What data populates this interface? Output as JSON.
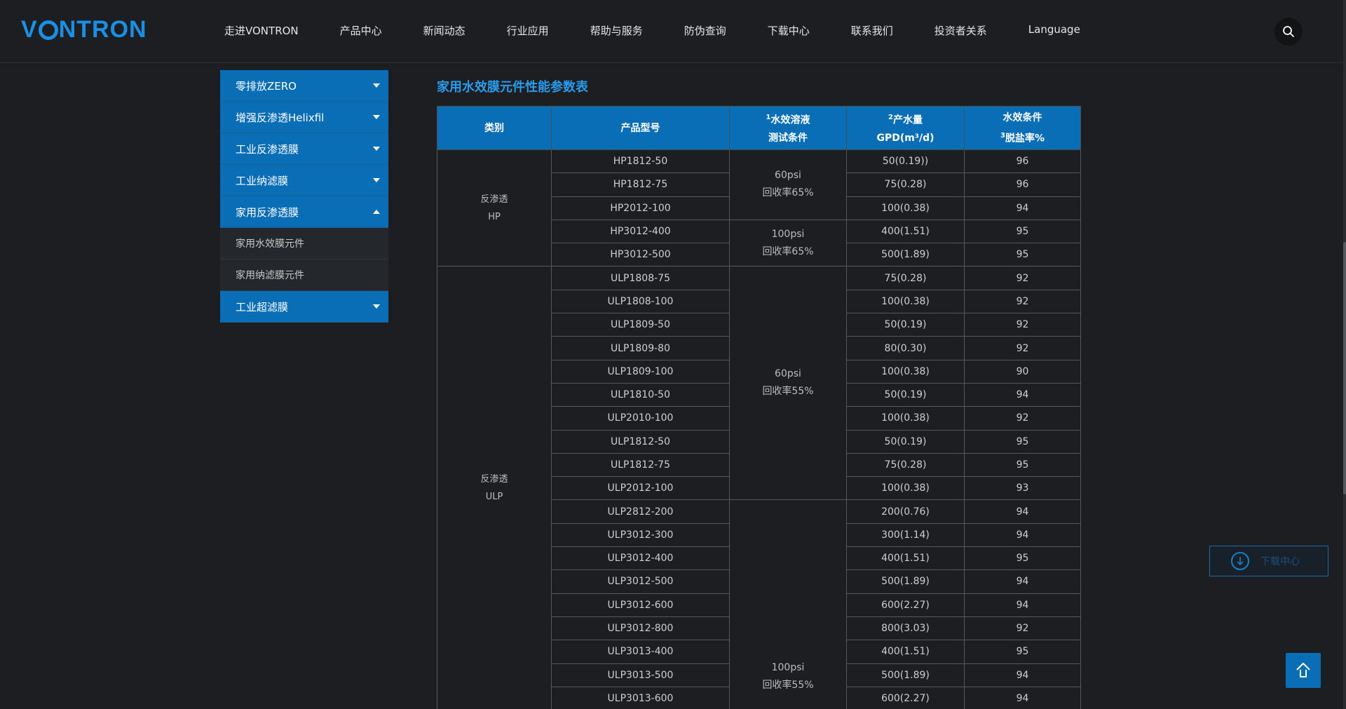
{
  "header": {
    "logo": {
      "pre": "V",
      "post": "NTRON"
    },
    "nav": [
      "走进VONTRON",
      "产品中心",
      "新闻动态",
      "行业应用",
      "帮助与服务",
      "防伪查询",
      "下载中心",
      "联系我们",
      "投资者关系",
      "Language"
    ]
  },
  "sidebar": {
    "top_items": [
      "零排放ZERO",
      "增强反渗透Helixfil",
      "工业反渗透膜",
      "工业纳滤膜",
      "家用反渗透膜"
    ],
    "sub_items": [
      "家用水效膜元件",
      "家用纳滤膜元件"
    ],
    "bottom_item": "工业超滤膜"
  },
  "main": {
    "title": "家用水效膜元件性能参数表",
    "columns": {
      "c1": "类别",
      "c2": "产品型号",
      "c3_sup": "1",
      "c3a": "水效溶液",
      "c3b": "测试条件",
      "c4_sup": "2",
      "c4a": "产水量",
      "c4b": "GPD(m³/d)",
      "c5a": "水效条件",
      "c5_sup": "3",
      "c5b": "脱盐率%"
    },
    "categories": {
      "hp": {
        "line1": "反渗透",
        "line2": "HP"
      },
      "ulp": {
        "line1": "反渗透",
        "line2": "ULP"
      }
    },
    "conditions": {
      "a": {
        "line1": "60psi",
        "line2": "回收率65%"
      },
      "b": {
        "line1": "100psi",
        "line2": "回收率65%"
      },
      "c": {
        "line1": "60psi",
        "line2": "回收率55%"
      },
      "d": {
        "line1": "100psi",
        "line2": "回收率55%"
      }
    },
    "rows": [
      {
        "model": "HP1812-50",
        "flow": "50(0.19))",
        "rejection": "96"
      },
      {
        "model": "HP1812-75",
        "flow": "75(0.28)",
        "rejection": "96"
      },
      {
        "model": "HP2012-100",
        "flow": "100(0.38)",
        "rejection": "94"
      },
      {
        "model": "HP3012-400",
        "flow": "400(1.51)",
        "rejection": "95"
      },
      {
        "model": "HP3012-500",
        "flow": "500(1.89)",
        "rejection": "95"
      },
      {
        "model": "ULP1808-75",
        "flow": "75(0.28)",
        "rejection": "92"
      },
      {
        "model": "ULP1808-100",
        "flow": "100(0.38)",
        "rejection": "92"
      },
      {
        "model": "ULP1809-50",
        "flow": "50(0.19)",
        "rejection": "92"
      },
      {
        "model": "ULP1809-80",
        "flow": "80(0.30)",
        "rejection": "92"
      },
      {
        "model": "ULP1809-100",
        "flow": "100(0.38)",
        "rejection": "90"
      },
      {
        "model": "ULP1810-50",
        "flow": "50(0.19)",
        "rejection": "94"
      },
      {
        "model": "ULP2010-100",
        "flow": "100(0.38)",
        "rejection": "92"
      },
      {
        "model": "ULP1812-50",
        "flow": "50(0.19)",
        "rejection": "95"
      },
      {
        "model": "ULP1812-75",
        "flow": "75(0.28)",
        "rejection": "95"
      },
      {
        "model": "ULP2012-100",
        "flow": "100(0.38)",
        "rejection": "93"
      },
      {
        "model": "ULP2812-200",
        "flow": "200(0.76)",
        "rejection": "94"
      },
      {
        "model": "ULP3012-300",
        "flow": "300(1.14)",
        "rejection": "94"
      },
      {
        "model": "ULP3012-400",
        "flow": "400(1.51)",
        "rejection": "95"
      },
      {
        "model": "ULP3012-500",
        "flow": "500(1.89)",
        "rejection": "94"
      },
      {
        "model": "ULP3012-600",
        "flow": "600(2.27)",
        "rejection": "94"
      },
      {
        "model": "ULP3012-800",
        "flow": "800(3.03)",
        "rejection": "92"
      },
      {
        "model": "ULP3013-400",
        "flow": "400(1.51)",
        "rejection": "95"
      },
      {
        "model": "ULP3013-500",
        "flow": "500(1.89)",
        "rejection": "94"
      },
      {
        "model": "ULP3013-600",
        "flow": "600(2.27)",
        "rejection": "94"
      }
    ]
  },
  "floating": {
    "download_label": "下载中心"
  },
  "icons": {
    "search": "search-icon",
    "download": "download-icon",
    "back_to_top": "back-to-top-icon"
  },
  "colors": {
    "accent": "#0a6eb6",
    "title": "#2a9bea",
    "background": "#1c1e21"
  }
}
